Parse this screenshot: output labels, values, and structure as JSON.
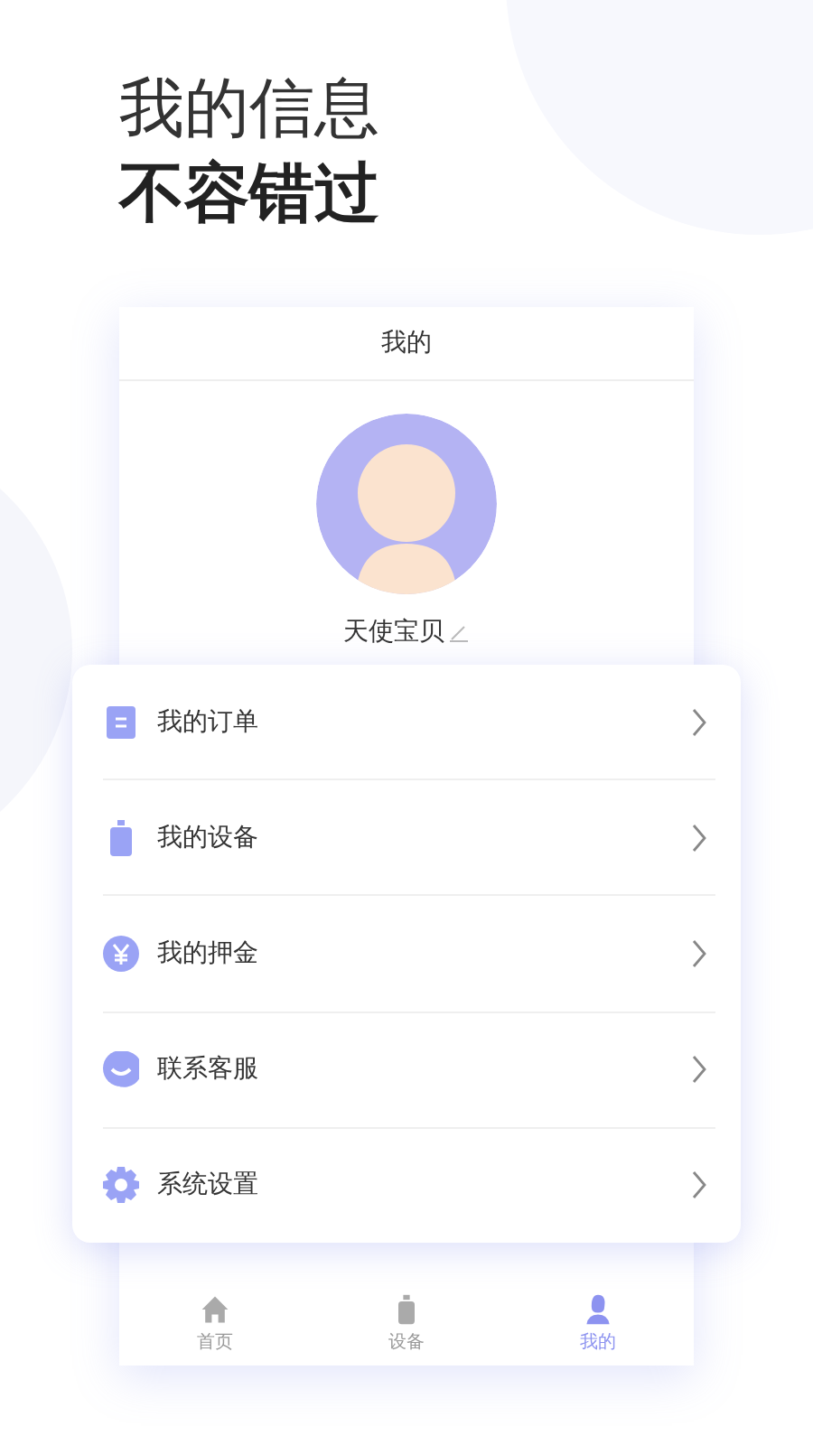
{
  "headline": {
    "line_1": "我的信息",
    "line_2": "不容错过"
  },
  "screen_title": "我的",
  "profile": {
    "name": "天使宝贝"
  },
  "menu": [
    {
      "label": "我的订单",
      "kind": "order"
    },
    {
      "label": "我的设备",
      "kind": "device"
    },
    {
      "label": "我的押金",
      "kind": "deposit"
    },
    {
      "label": "联系客服",
      "kind": "service"
    },
    {
      "label": "系统设置",
      "kind": "settings"
    }
  ],
  "tab_bar": [
    {
      "label": "首页",
      "kind": "home",
      "selected": false
    },
    {
      "label": "设备",
      "kind": "device",
      "selected": false
    },
    {
      "label": "我的",
      "kind": "me",
      "selected": true
    }
  ]
}
